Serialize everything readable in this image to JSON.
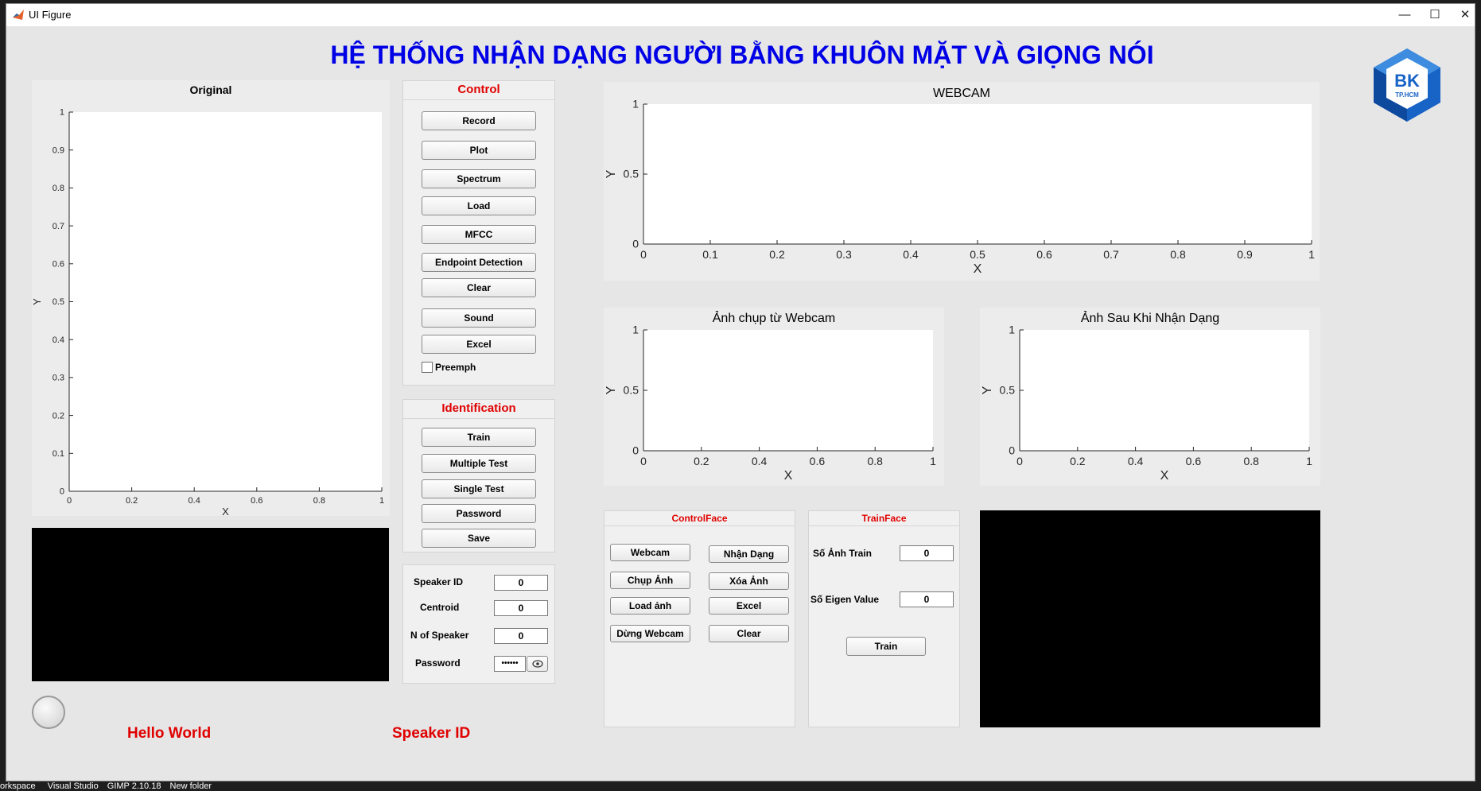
{
  "window": {
    "title": "UI Figure",
    "minimize": "—",
    "maximize": "☐",
    "close": "✕"
  },
  "main_title": "HỆ THỐNG NHẬN DẠNG NGƯỜI BẰNG KHUÔN MẶT VÀ GIỌNG NÓI",
  "logo": {
    "line1": "BK",
    "line2": "TP.HCM",
    "color": "#1863c6"
  },
  "axes": {
    "original": {
      "title": "Original",
      "xlabel": "X",
      "ylabel": "Y",
      "xticks": [
        "0",
        "0.2",
        "0.4",
        "0.6",
        "0.8",
        "1"
      ],
      "yticks": [
        "0",
        "0.1",
        "0.2",
        "0.3",
        "0.4",
        "0.5",
        "0.6",
        "0.7",
        "0.8",
        "0.9",
        "1"
      ]
    },
    "webcam": {
      "title": "WEBCAM",
      "xlabel": "X",
      "ylabel": "Y",
      "xticks": [
        "0",
        "0.1",
        "0.2",
        "0.3",
        "0.4",
        "0.5",
        "0.6",
        "0.7",
        "0.8",
        "0.9",
        "1"
      ],
      "yticks": [
        "0",
        "0.5",
        "1"
      ]
    },
    "captured": {
      "title": "Ảnh chụp từ Webcam",
      "xlabel": "X",
      "ylabel": "Y",
      "xticks": [
        "0",
        "0.2",
        "0.4",
        "0.6",
        "0.8",
        "1"
      ],
      "yticks": [
        "0",
        "0.5",
        "1"
      ]
    },
    "recognized": {
      "title": "Ảnh Sau Khi Nhận Dạng",
      "xlabel": "X",
      "ylabel": "Y",
      "xticks": [
        "0",
        "0.2",
        "0.4",
        "0.6",
        "0.8",
        "1"
      ],
      "yticks": [
        "0",
        "0.5",
        "1"
      ]
    }
  },
  "control": {
    "title": "Control",
    "buttons": [
      "Record",
      "Plot",
      "Spectrum",
      "Load",
      "MFCC",
      "Endpoint Detection",
      "Clear",
      "Sound",
      "Excel"
    ],
    "preemph_label": "Preemph",
    "preemph_checked": false
  },
  "identification": {
    "title": "Identification",
    "buttons": [
      "Train",
      "Multiple Test",
      "Single Test",
      "Password",
      "Save"
    ]
  },
  "speaker_fields": {
    "speaker_id": {
      "label": "Speaker ID",
      "value": "0"
    },
    "centroid": {
      "label": "Centroid",
      "value": "0"
    },
    "n_speaker": {
      "label": "N of Speaker",
      "value": "0"
    },
    "password": {
      "label": "Password",
      "value": "••••••",
      "eye_icon": "eye-icon"
    }
  },
  "control_face": {
    "title": "ControlFace",
    "left_buttons": [
      "Webcam",
      "Chụp Ảnh",
      "Load ảnh",
      "Dừng Webcam"
    ],
    "right_buttons": [
      "Nhận Dạng",
      "Xóa Ảnh",
      "Excel",
      "Clear"
    ]
  },
  "train_face": {
    "title": "TrainFace",
    "so_anh_train": {
      "label": "Số Ảnh Train",
      "value": "0"
    },
    "so_eigen": {
      "label": "Số Eigen Value",
      "value": "0"
    },
    "train_button": "Train"
  },
  "status": {
    "hello": "Hello World",
    "speaker": "Speaker ID"
  },
  "taskbar": [
    "orkspace",
    "Visual Studio",
    "GIMP 2.10.18",
    "New folder"
  ]
}
